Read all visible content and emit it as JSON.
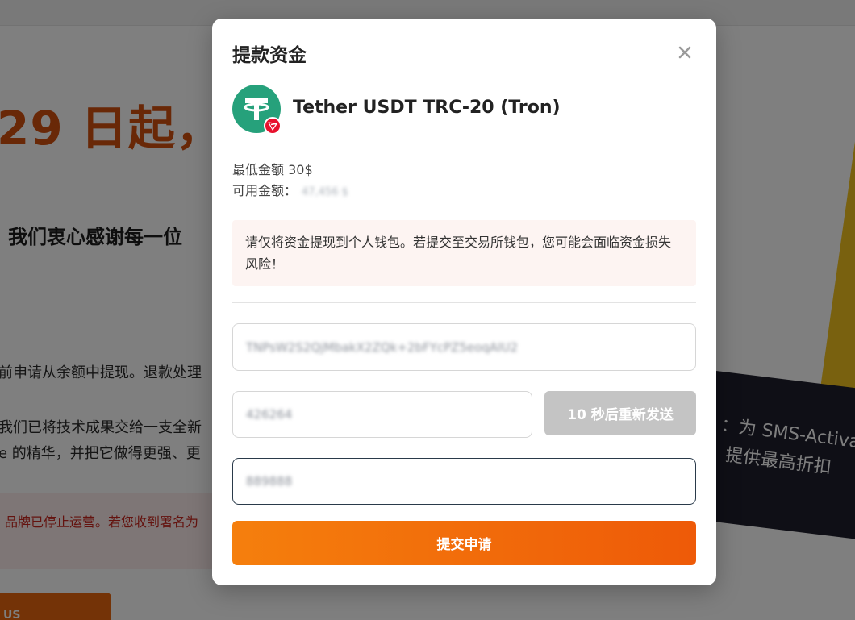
{
  "background": {
    "headline": "29 日起，",
    "headline_tail": "",
    "thanks": "我们衷心感谢每一位",
    "paragraph1": "前申请从余额中提现。退款处理",
    "paragraph2": "我们已将技术成果交给一支全新",
    "paragraph3": "e 的精华，并把它做得更强、更",
    "notice": "品牌已停止运营。若您收到署名为",
    "button": "US",
    "banner_line1": "：为 SMS-Activa",
    "banner_line2": "提供最高折扣"
  },
  "modal": {
    "title": "提款资金",
    "close_icon": "close-icon",
    "coin": {
      "icon": "tether-icon",
      "network_icon": "tron-icon",
      "name": "Tether USDT TRC-20 (Tron)"
    },
    "min_amount": "最低金额 30$",
    "available_label": "可用金额：",
    "available_value": "47,456 $",
    "warning": "请仅将资金提现到个人钱包。若提交至交易所钱包，您可能会面临资金损失风险！",
    "address_value": "TNPsW2S2QjMbakX2ZQk+2bFYcPZ5eoqAIU2",
    "code_value": "426264",
    "resend_label": "10 秒后重新发送",
    "twofa_value": "889888",
    "submit_label": "提交申请"
  },
  "colors": {
    "accent": "#f57f0d",
    "accent_end": "#ee5a08",
    "tether": "#26a17b",
    "tron": "#e8112d",
    "disabled": "#c4c4c4",
    "warning_bg": "#fdf4f2"
  }
}
